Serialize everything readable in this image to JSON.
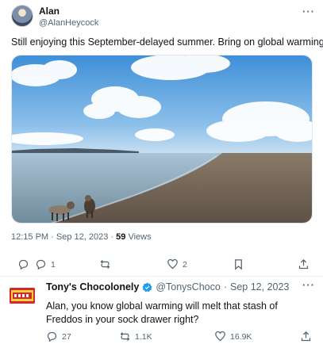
{
  "tweet": {
    "author_name": "Alan",
    "author_handle": "@AlanHeycock",
    "text": "Still enjoying this September-delayed summer. Bring on global warming.",
    "time": "12:15 PM",
    "date": "Sep 12, 2023",
    "meta_separator": "·",
    "views_count": "59",
    "views_label": "Views",
    "replies_count": "1",
    "likes_count": "2",
    "more_label": "···"
  },
  "reply": {
    "author_name": "Tony's Chocolonely",
    "author_handle": "@TonysChoco",
    "separator": "·",
    "date": "Sep 12, 2023",
    "text": "Alan, you know global warming will melt that stash of Freddos in your sock drawer right?",
    "replies_count": "27",
    "retweets_count": "1.1K",
    "likes_count": "16.9K",
    "more_label": "···"
  },
  "colors": {
    "secondary_text": "#536471",
    "verified_blue": "#1d9bf0",
    "brand_red": "#d9262e"
  }
}
